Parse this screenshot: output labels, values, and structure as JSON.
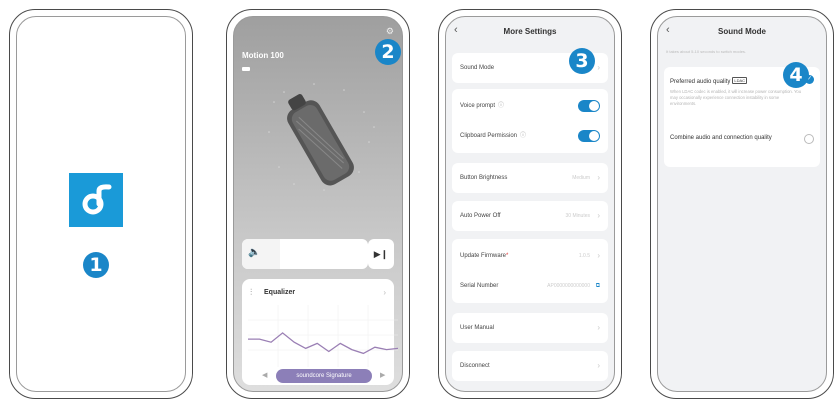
{
  "steps": {
    "s1": "1",
    "s2": "2",
    "s3": "3",
    "s4": "4"
  },
  "colors": {
    "accent": "#1a86c8",
    "logo": "#1a9ad8",
    "preset": "#8c7fb8",
    "eq_line": "#9a7fb4"
  },
  "phone2": {
    "device_name": "Motion 100",
    "volume_level": 0.3,
    "equalizer_title": "Equalizer",
    "preset": "soundcore Signature",
    "eq_curve": [
      0.55,
      0.55,
      0.6,
      0.45,
      0.6,
      0.7,
      0.62,
      0.75,
      0.62,
      0.72,
      0.78,
      0.68,
      0.72,
      0.7
    ]
  },
  "phone3": {
    "title": "More Settings",
    "rows": {
      "sound_mode": "Sound Mode",
      "voice_prompt": "Voice prompt",
      "clipboard": "Clipboard Permission",
      "brightness": "Button Brightness",
      "brightness_value": "Medium",
      "auto_off": "Auto Power Off",
      "auto_off_value": "30 Minutes",
      "firmware": "Update Firmware",
      "firmware_value": "1.0.5",
      "serial": "Serial Number",
      "serial_value": "AP0000000000000",
      "manual": "User Manual",
      "disconnect": "Disconnect"
    }
  },
  "phone4": {
    "title": "Sound Mode",
    "hint": "It takes about 5-10 seconds to switch modes.",
    "opt1": "Preferred audio quality",
    "opt1_badge": "LDAC",
    "opt1_desc": "When LDAC codec is enabled, it will increase power consumption. You may occasionally experience connection instability in some environments.",
    "opt2": "Combine audio and connection quality"
  }
}
